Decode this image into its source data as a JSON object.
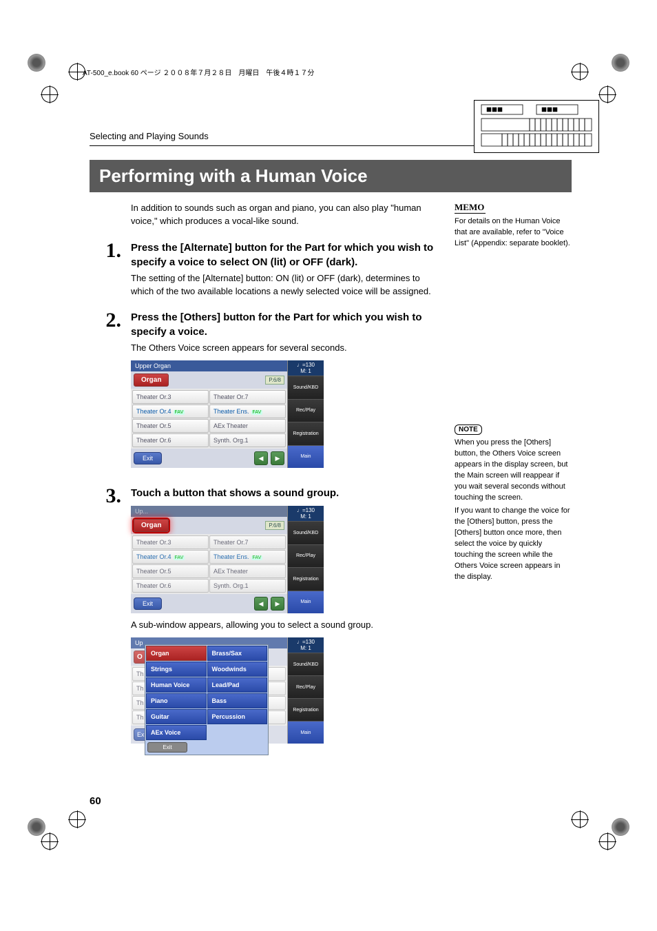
{
  "meta": {
    "booknote": "AT-500_e.book  60 ページ  ２００８年７月２８日　月曜日　午後４時１７分"
  },
  "header": {
    "section": "Selecting and Playing Sounds"
  },
  "title": "Performing with a Human Voice",
  "intro": "In addition to sounds such as organ and piano, you can also play \"human voice,\" which produces a vocal-like sound.",
  "steps": [
    {
      "num": "1.",
      "title": "Press the [Alternate] button for the Part for which you wish to specify a voice to select ON (lit) or OFF (dark).",
      "text": "The setting of the [Alternate] button: ON (lit) or OFF (dark), determines to which of the two available locations a newly selected voice will be assigned."
    },
    {
      "num": "2.",
      "title": "Press the [Others] button for the Part for which you wish to specify a voice.",
      "text": "The Others Voice screen appears for several seconds."
    },
    {
      "num": "3.",
      "title": "Touch a button that shows a sound group.",
      "text": "A sub-window appears, allowing you to select a sound group."
    }
  ],
  "sidebar": {
    "memo": {
      "label": "MEMO",
      "text": "For details on the Human Voice that are available, refer to \"Voice List\" (Appendix: separate booklet)."
    },
    "note": {
      "label": "NOTE",
      "text1": "When you press the [Others] button, the Others Voice screen appears in the display screen, but the Main screen will reappear if you wait several seconds without touching the screen.",
      "text2": "If you want to change the voice for the [Others] button, press the [Others] button once more, then select the voice by quickly touching the screen while the Others Voice screen appears in the display."
    }
  },
  "screenshot_voice": {
    "header": "Upper Organ",
    "tab": "Organ",
    "page": "P.6/8",
    "cells": [
      "Theater Or.3",
      "Theater Or.7",
      "Theater Or.4",
      "Theater Ens.",
      "Theater Or.5",
      "AEx Theater",
      "Theater Or.6",
      "Synth. Org.1"
    ],
    "exit": "Exit",
    "tempo": "♩=130",
    "measure": "M:    1",
    "rbuttons": [
      "Sound/KBD",
      "Rec/Play",
      "Registration",
      "Main"
    ]
  },
  "popup": {
    "cells": [
      "Organ",
      "Brass/Sax",
      "Strings",
      "Woodwinds",
      "Human Voice",
      "Lead/Pad",
      "Piano",
      "Bass",
      "Guitar",
      "Percussion",
      "AEx Voice"
    ],
    "exit": "Exit"
  },
  "page_num": "60"
}
